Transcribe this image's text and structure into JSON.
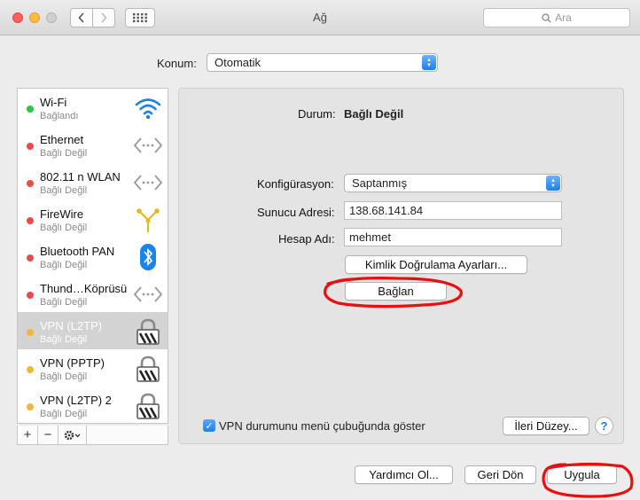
{
  "window": {
    "title": "Ağ",
    "search_placeholder": "Ara"
  },
  "location": {
    "label": "Konum:",
    "value": "Otomatik"
  },
  "services": [
    {
      "name": "Wi-Fi",
      "status": "Bağlandı",
      "dot": "#2bc840",
      "icon": "wifi-icon"
    },
    {
      "name": "Ethernet",
      "status": "Bağlı Değil",
      "dot": "#ee4b46",
      "icon": "ethernet-icon"
    },
    {
      "name": "802.11 n WLAN",
      "status": "Bağlı Değil",
      "dot": "#ee4b46",
      "icon": "ethernet-icon"
    },
    {
      "name": "FireWire",
      "status": "Bağlı Değil",
      "dot": "#ee4b46",
      "icon": "firewire-icon"
    },
    {
      "name": "Bluetooth PAN",
      "status": "Bağlı Değil",
      "dot": "#ee4b46",
      "icon": "bluetooth-icon"
    },
    {
      "name": "Thund…Köprüsü",
      "status": "Bağlı Değil",
      "dot": "#ee4b46",
      "icon": "ethernet-icon"
    },
    {
      "name": "VPN (L2TP)",
      "status": "Bağlı Değil",
      "dot": "#f5b53c",
      "icon": "lock-icon"
    },
    {
      "name": "VPN (PPTP)",
      "status": "Bağlı Değil",
      "dot": "#f5b53c",
      "icon": "lock-icon"
    },
    {
      "name": "VPN (L2TP) 2",
      "status": "Bağlı Değil",
      "dot": "#f5b53c",
      "icon": "lock-icon"
    }
  ],
  "sidebar_toolbar": {
    "add": "+",
    "remove": "−"
  },
  "detail": {
    "status_label": "Durum:",
    "status_value": "Bağlı Değil",
    "config_label": "Konfigürasyon:",
    "config_value": "Saptanmış",
    "server_label": "Sunucu Adresi:",
    "server_value": "138.68.141.84",
    "account_label": "Hesap Adı:",
    "account_value": "mehmet",
    "auth_button": "Kimlik Doğrulama Ayarları...",
    "connect_button": "Bağlan",
    "show_vpn_label": "VPN durumunu menü çubuğunda göster",
    "show_vpn_checked": true,
    "advanced_button": "İleri Düzey...",
    "help": "?"
  },
  "footer": {
    "assistant_button": "Yardımcı Ol...",
    "revert_button": "Geri Dön",
    "apply_button": "Uygula"
  },
  "colors": {
    "accent": "#1d7ff3",
    "selection": "#d3d3d3",
    "annotation": "#e8100f"
  }
}
